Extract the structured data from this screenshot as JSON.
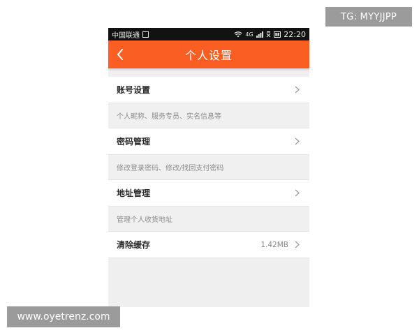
{
  "status_bar": {
    "carrier": "中国联通",
    "network": "4G",
    "time": "22:20",
    "icons": [
      "sim-icon",
      "wifi-icon",
      "signal-icon",
      "battery-icon"
    ]
  },
  "header": {
    "title": "个人设置",
    "back_icon": "chevron-left-icon"
  },
  "settings": {
    "account": {
      "label": "账号设置",
      "caption": "个人昵称、服务专员、实名信息等"
    },
    "password": {
      "label": "密码管理",
      "caption": "修改登录密码、修改/找回支付密码"
    },
    "address": {
      "label": "地址管理",
      "caption": "管理个人收货地址"
    },
    "cache": {
      "label": "清除缓存",
      "value": "1.42MB"
    }
  },
  "watermarks": {
    "top_right": "TG: MYYJJPP",
    "bottom_left": "www.oyetrenz.com"
  },
  "colors": {
    "header_bg": "#fb5e23",
    "status_bar_bg": "#121212",
    "page_bg": "#efefef",
    "badge_bg": "#9b9b9b"
  }
}
